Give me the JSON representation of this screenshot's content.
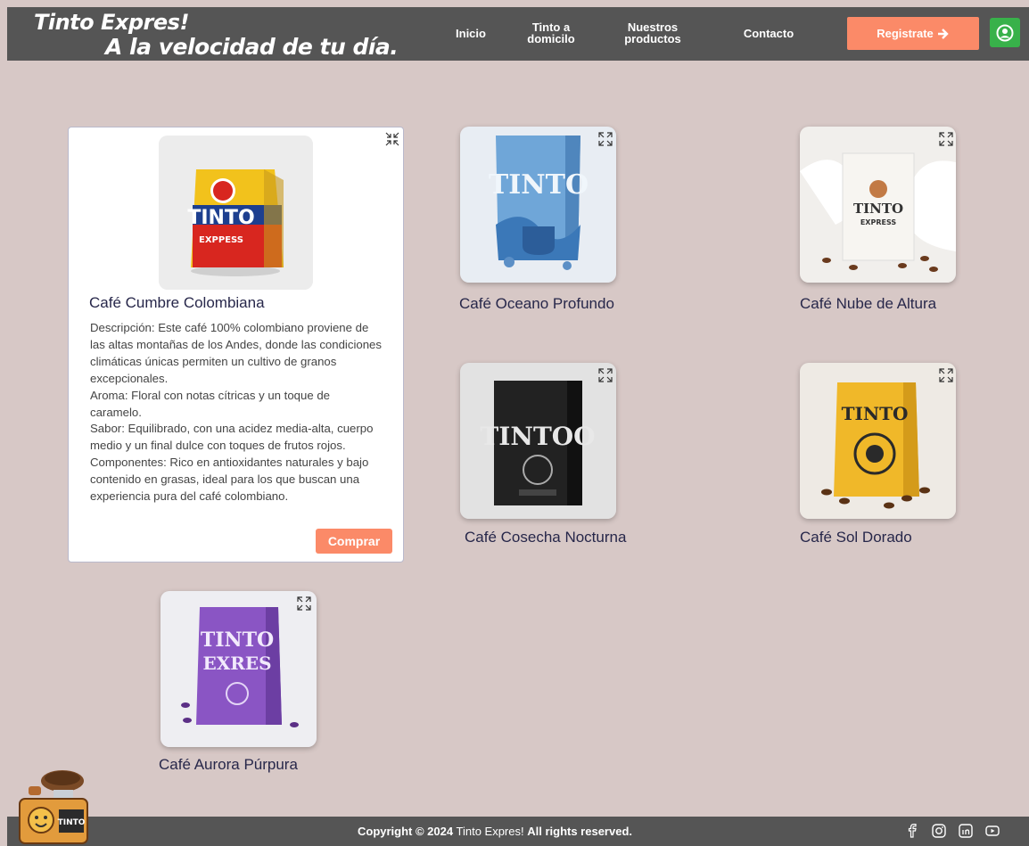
{
  "header": {
    "brand_line1": "Tinto Expres!",
    "brand_line2": "A la velocidad de tu día.",
    "nav": [
      {
        "line1": "Inicio",
        "line2": ""
      },
      {
        "line1": "Tinto a",
        "line2": "domicilo"
      },
      {
        "line1": "Nuestros",
        "line2": "productos"
      },
      {
        "line1": "Contacto",
        "line2": ""
      }
    ],
    "register_label": "Registrate",
    "register_icon": "arrow-right-icon",
    "user_icon": "user-circle-icon"
  },
  "products": [
    {
      "name": "Café Cumbre Colombiana",
      "expanded": true,
      "image_text": "TINTO EXPPESS",
      "description": [
        "Descripción: Este café 100% colombiano proviene de las altas montañas de los Andes, donde las condiciones climáticas únicas permiten un cultivo de granos excepcionales.",
        "Aroma: Floral con notas cítricas y un toque de caramelo.",
        "Sabor: Equilibrado, con una acidez media-alta, cuerpo medio y un final dulce con toques de frutos rojos.",
        "Componentes: Rico en antioxidantes naturales y bajo contenido en grasas, ideal para los que buscan una experiencia pura del café colombiano."
      ],
      "buy_label": "Comprar"
    },
    {
      "name": "Café Oceano Profundo",
      "expanded": false,
      "image_text": "TINTO"
    },
    {
      "name": "Café Nube de Altura",
      "expanded": false,
      "image_text": "TINTO EXPRESS"
    },
    {
      "name": "Café Cosecha Nocturna",
      "expanded": false,
      "image_text": "TINTOO"
    },
    {
      "name": "Café Sol Dorado",
      "expanded": false,
      "image_text": "TINTO"
    },
    {
      "name": "Café Aurora Púrpura",
      "expanded": false,
      "image_text": "TINTO EXRES"
    }
  ],
  "footer": {
    "copyright_prefix": "Copyright © 2024",
    "brand": "Tinto Expres!",
    "rights": "All rights reserved.",
    "social": [
      "facebook-icon",
      "instagram-icon",
      "linkedin-icon",
      "youtube-icon"
    ]
  },
  "colors": {
    "background": "#d7c8c6",
    "header": "#555555",
    "accent": "#fb8a68",
    "user_button": "#38b14a"
  }
}
